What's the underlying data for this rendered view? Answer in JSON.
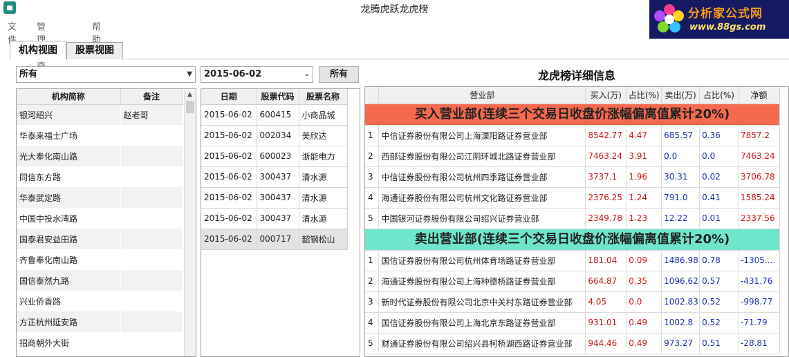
{
  "window": {
    "title": "龙腾虎跃龙虎榜"
  },
  "logo": {
    "line1": "分析家公式网",
    "line2": "www.88gs.com"
  },
  "menu": [
    "文件",
    "管理与查询",
    "帮助"
  ],
  "tabs": [
    "机构视图",
    "股票视图"
  ],
  "left": {
    "filter_value": "所有",
    "columns": [
      "机构简称",
      "备注"
    ],
    "rows": [
      [
        "银河绍兴",
        "赵老哥"
      ],
      [
        "华泰来福士广场",
        ""
      ],
      [
        "光大奉化南山路",
        ""
      ],
      [
        "同信东方路",
        ""
      ],
      [
        "华泰武定路",
        ""
      ],
      [
        "中国中投水湾路",
        ""
      ],
      [
        "国泰君安益田路",
        ""
      ],
      [
        "齐鲁奉化南山路",
        ""
      ],
      [
        "国信泰然九路",
        ""
      ],
      [
        "兴业侨香路",
        ""
      ],
      [
        "方正杭州延安路",
        ""
      ],
      [
        "招商朝外大街",
        ""
      ]
    ]
  },
  "middle": {
    "date_value": "2015-06-02",
    "button_label": "所有",
    "columns": [
      "日期",
      "股票代码",
      "股票名称"
    ],
    "rows": [
      [
        "2015-06-02",
        "600415",
        "小商品城"
      ],
      [
        "2015-06-02",
        "002034",
        "美欣达"
      ],
      [
        "2015-06-02",
        "600023",
        "浙能电力"
      ],
      [
        "2015-06-02",
        "300437",
        "清水源"
      ],
      [
        "2015-06-02",
        "300437",
        "清水源"
      ],
      [
        "2015-06-02",
        "300437",
        "清水源"
      ],
      [
        "2015-06-02",
        "000717",
        "韶钢松山"
      ]
    ]
  },
  "detail": {
    "title": "龙虎榜详细信息",
    "columns": [
      "",
      "营业部",
      "买入(万)",
      "占比(%)",
      "卖出(万)",
      "占比(%)",
      "净额"
    ],
    "buy_section": "买入营业部(连续三个交易日收盘价涨幅偏离值累计20%)",
    "buy_rows": [
      [
        "1",
        "中信证券股份有限公司上海溧阳路证券营业部",
        "8542.77",
        "4.47",
        "685.57",
        "0.36",
        "7857.2"
      ],
      [
        "2",
        "西部证券股份有限公司江阴环城北路证券营业部",
        "7463.24",
        "3.91",
        "0.0",
        "0.0",
        "7463.24"
      ],
      [
        "3",
        "中信证券股份有限公司杭州四季路证券营业部",
        "3737.1",
        "1.96",
        "30.31",
        "0.02",
        "3706.78"
      ],
      [
        "4",
        "海通证券股份有限公司杭州文化路证券营业部",
        "2376.25",
        "1.24",
        "791.0",
        "0.41",
        "1585.24"
      ],
      [
        "5",
        "中国银河证券股份有限公司绍兴证券营业部",
        "2349.78",
        "1.23",
        "12.22",
        "0.01",
        "2337.56"
      ]
    ],
    "sell_section": "卖出营业部(连续三个交易日收盘价涨幅偏离值累计20%)",
    "sell_rows": [
      [
        "1",
        "国信证券股份有限公司杭州体育场路证券营业部",
        "181.04",
        "0.09",
        "1486.98",
        "0.78",
        "-1305...."
      ],
      [
        "2",
        "海通证券股份有限公司上海种德桥路证券营业部",
        "664.87",
        "0.35",
        "1096.62",
        "0.57",
        "-431.76"
      ],
      [
        "3",
        "新时代证券股份有限公司北京中关村东路证券营业部",
        "4.05",
        "0.0",
        "1002.83",
        "0.52",
        "-998.77"
      ],
      [
        "4",
        "国信证券股份有限公司上海北京东路证券营业部",
        "931.01",
        "0.49",
        "1002.8",
        "0.52",
        "-71.79"
      ],
      [
        "5",
        "财通证券股份有限公司绍兴县柯桥湖西路证券营业部",
        "944.46",
        "0.49",
        "973.27",
        "0.51",
        "-28.81"
      ]
    ]
  }
}
